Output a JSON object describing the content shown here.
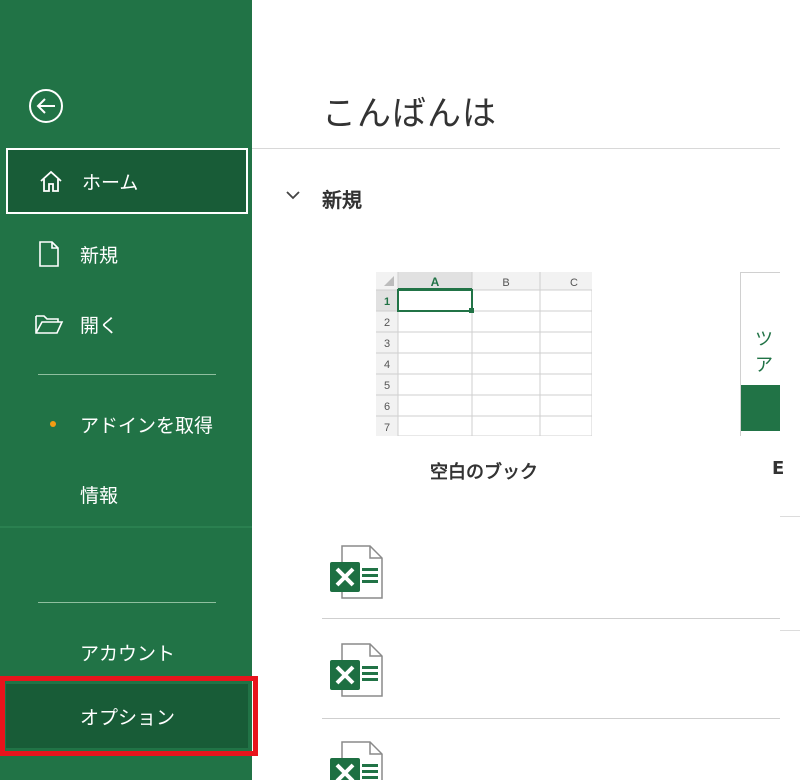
{
  "sidebar": {
    "back_icon": "back-arrow-icon",
    "items": [
      {
        "id": "home",
        "label": "ホーム",
        "icon": "home-icon"
      },
      {
        "id": "new",
        "label": "新規",
        "icon": "new-document-icon"
      },
      {
        "id": "open",
        "label": "開く",
        "icon": "folder-open-icon"
      },
      {
        "id": "get_addins",
        "label": "アドインを取得"
      },
      {
        "id": "info",
        "label": "情報"
      },
      {
        "id": "account",
        "label": "アカウント"
      },
      {
        "id": "options",
        "label": "オプション"
      }
    ],
    "active_item": "home",
    "highlighted_item": "options",
    "colors": {
      "bg": "#217346",
      "active_bg": "#185c37",
      "dot": "#f39c12",
      "highlight": "#e8141c"
    }
  },
  "main": {
    "greeting": "こんばんは",
    "new_section": {
      "title": "新規",
      "templates": [
        {
          "label": "空白のブック",
          "grid": {
            "columns": [
              "A",
              "B",
              "C"
            ],
            "rows": [
              "1",
              "2",
              "3",
              "4",
              "5",
              "6",
              "7"
            ]
          }
        },
        {
          "label": "E",
          "preview_text": "ツア"
        }
      ]
    },
    "recent_files": [
      {
        "icon": "excel-file-icon"
      },
      {
        "icon": "excel-file-icon"
      },
      {
        "icon": "excel-file-icon"
      }
    ]
  }
}
